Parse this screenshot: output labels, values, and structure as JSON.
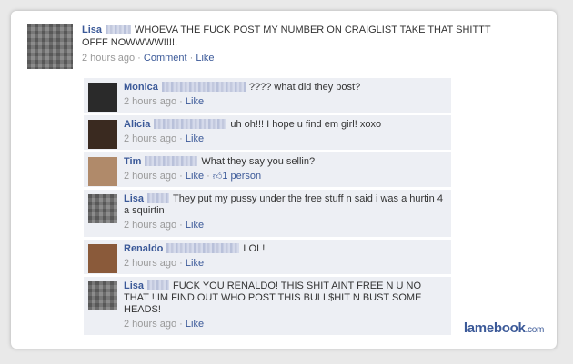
{
  "post": {
    "name": "Lisa",
    "text": "WHOEVA THE FUCK POST MY NUMBER ON CRAIGLIST TAKE THAT SHITTT OFFF NOWWWW!!!!.",
    "time": "2 hours ago",
    "sep1": " · ",
    "comment_label": "Comment",
    "sep2": " · ",
    "like_label": "Like"
  },
  "comments": [
    {
      "name": "Monica",
      "text": "???? what did they post?",
      "time": "2 hours ago",
      "like": "Like"
    },
    {
      "name": "Alicia",
      "text": "uh oh!!! I hope u find em girl! xoxo",
      "time": "2 hours ago",
      "like": "Like"
    },
    {
      "name": "Tim",
      "text": "What they say you sellin?",
      "time": "2 hours ago",
      "like": "Like",
      "likes": "1 person"
    },
    {
      "name": "Lisa",
      "text": "They put my pussy under the free stuff n said i was a hurtin 4 a squirtin",
      "time": "2 hours ago",
      "like": "Like"
    },
    {
      "name": "Renaldo",
      "text": "LOL!",
      "time": "2 hours ago",
      "like": "Like"
    },
    {
      "name": "Lisa",
      "text": "FUCK YOU RENALDO! THIS SHIT AINT FREE N U NO THAT ! IM FIND OUT WHO POST THIS BULL$HIT N BUST SOME HEADS!",
      "time": "2 hours ago",
      "like": "Like"
    }
  ],
  "logo": {
    "brand": "lamebook",
    "domain": ".com"
  },
  "colors": {
    "link": "#3b5998",
    "comment_bg": "#edeff4",
    "meta": "#999999"
  }
}
